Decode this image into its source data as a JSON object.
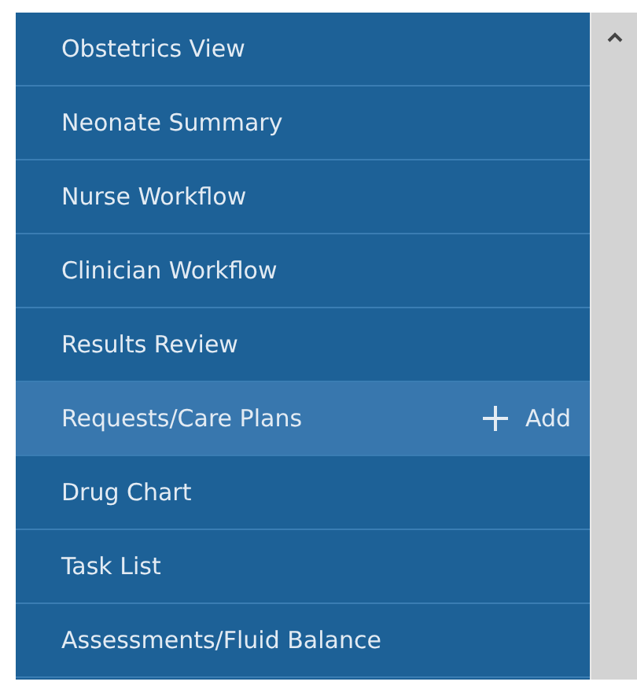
{
  "menu": {
    "items": [
      {
        "label": "Obstetrics View",
        "selected": false
      },
      {
        "label": "Neonate Summary",
        "selected": false
      },
      {
        "label": "Nurse Workflow",
        "selected": false
      },
      {
        "label": "Clinician Workflow",
        "selected": false
      },
      {
        "label": "Results Review",
        "selected": false
      },
      {
        "label": "Requests/Care Plans",
        "selected": true,
        "action": "Add"
      },
      {
        "label": "Drug Chart",
        "selected": false
      },
      {
        "label": "Task List",
        "selected": false
      },
      {
        "label": "Assessments/Fluid Balance",
        "selected": false
      }
    ]
  }
}
